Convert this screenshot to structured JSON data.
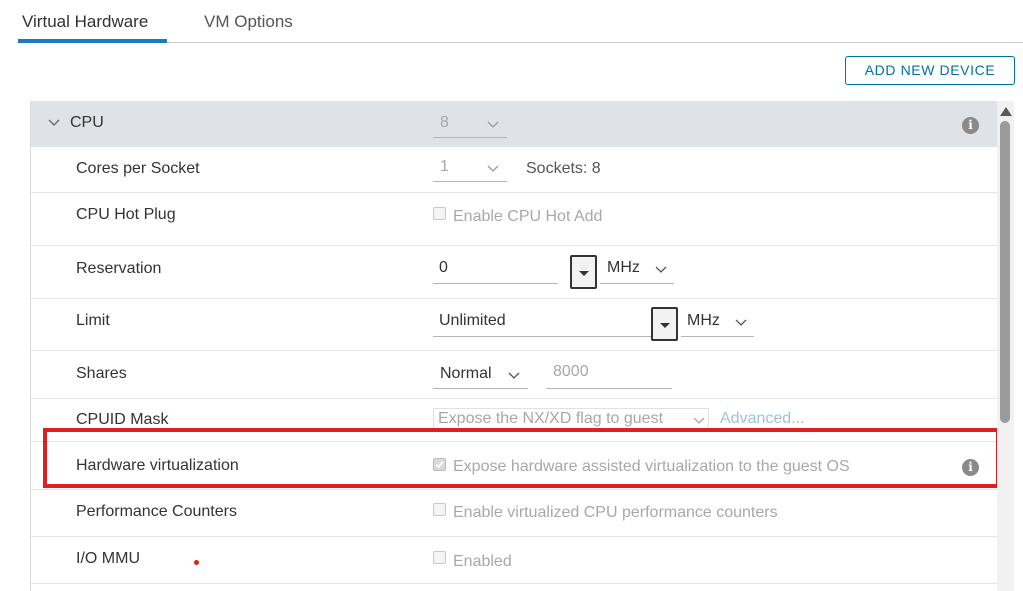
{
  "tabs": [
    {
      "label": "Virtual Hardware",
      "active": true
    },
    {
      "label": "VM Options",
      "active": false
    }
  ],
  "add_device_label": "ADD NEW DEVICE",
  "cpu": {
    "label": "CPU",
    "count": "8",
    "cores_per_socket": {
      "label": "Cores per Socket",
      "value": "1",
      "sockets_text": "Sockets: 8"
    },
    "hot_plug": {
      "label": "CPU Hot Plug",
      "checkbox_text": "Enable CPU Hot Add",
      "checked": false
    },
    "reservation": {
      "label": "Reservation",
      "value": "0",
      "unit": "MHz"
    },
    "limit": {
      "label": "Limit",
      "value": "Unlimited",
      "unit": "MHz"
    },
    "shares": {
      "label": "Shares",
      "level": "Normal",
      "value": "8000"
    },
    "cpuid_mask": {
      "label": "CPUID Mask",
      "value": "Expose the NX/XD flag to guest",
      "link": "Advanced..."
    },
    "hw_virtualization": {
      "label": "Hardware virtualization",
      "checkbox_text": "Expose hardware assisted virtualization to the guest OS",
      "checked": true
    },
    "perf_counters": {
      "label": "Performance Counters",
      "checkbox_text": "Enable virtualized CPU performance counters",
      "checked": false
    },
    "io_mmu": {
      "label": "I/O MMU",
      "checkbox_text": "Enabled",
      "checked": false
    }
  },
  "colors": {
    "accent": "#0072a3",
    "highlight": "#e02020",
    "header_bg": "#dfe3e8"
  }
}
